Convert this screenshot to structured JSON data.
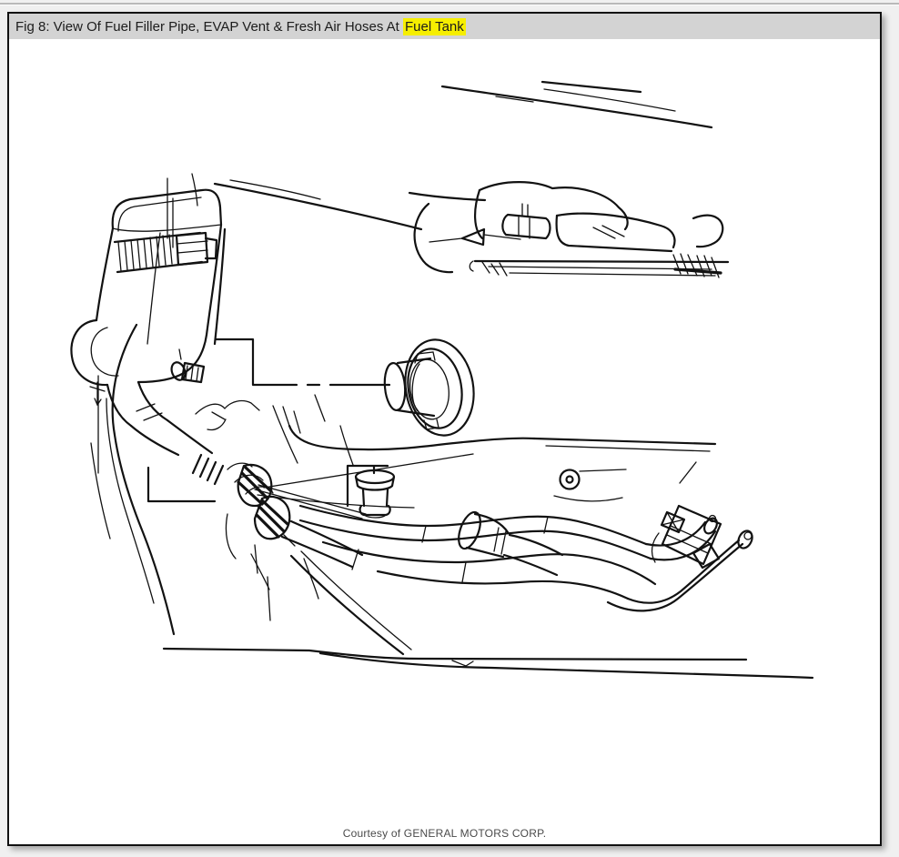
{
  "window": {
    "outer_background": "#f0f0f0",
    "frame_border_color": "#111111",
    "content_background": "#ffffff"
  },
  "header": {
    "title_prefix": "Fig 8: View Of Fuel Filler Pipe, EVAP Vent & Fresh Air Hoses At ",
    "title_highlight": "Fuel Tank",
    "background": "#d3d3d3",
    "highlight_color": "#f6ee00",
    "text_color": "#1c1c1c"
  },
  "figure": {
    "credit": "Courtesy of GENERAL MOTORS CORP.",
    "line_color": "#121212"
  }
}
